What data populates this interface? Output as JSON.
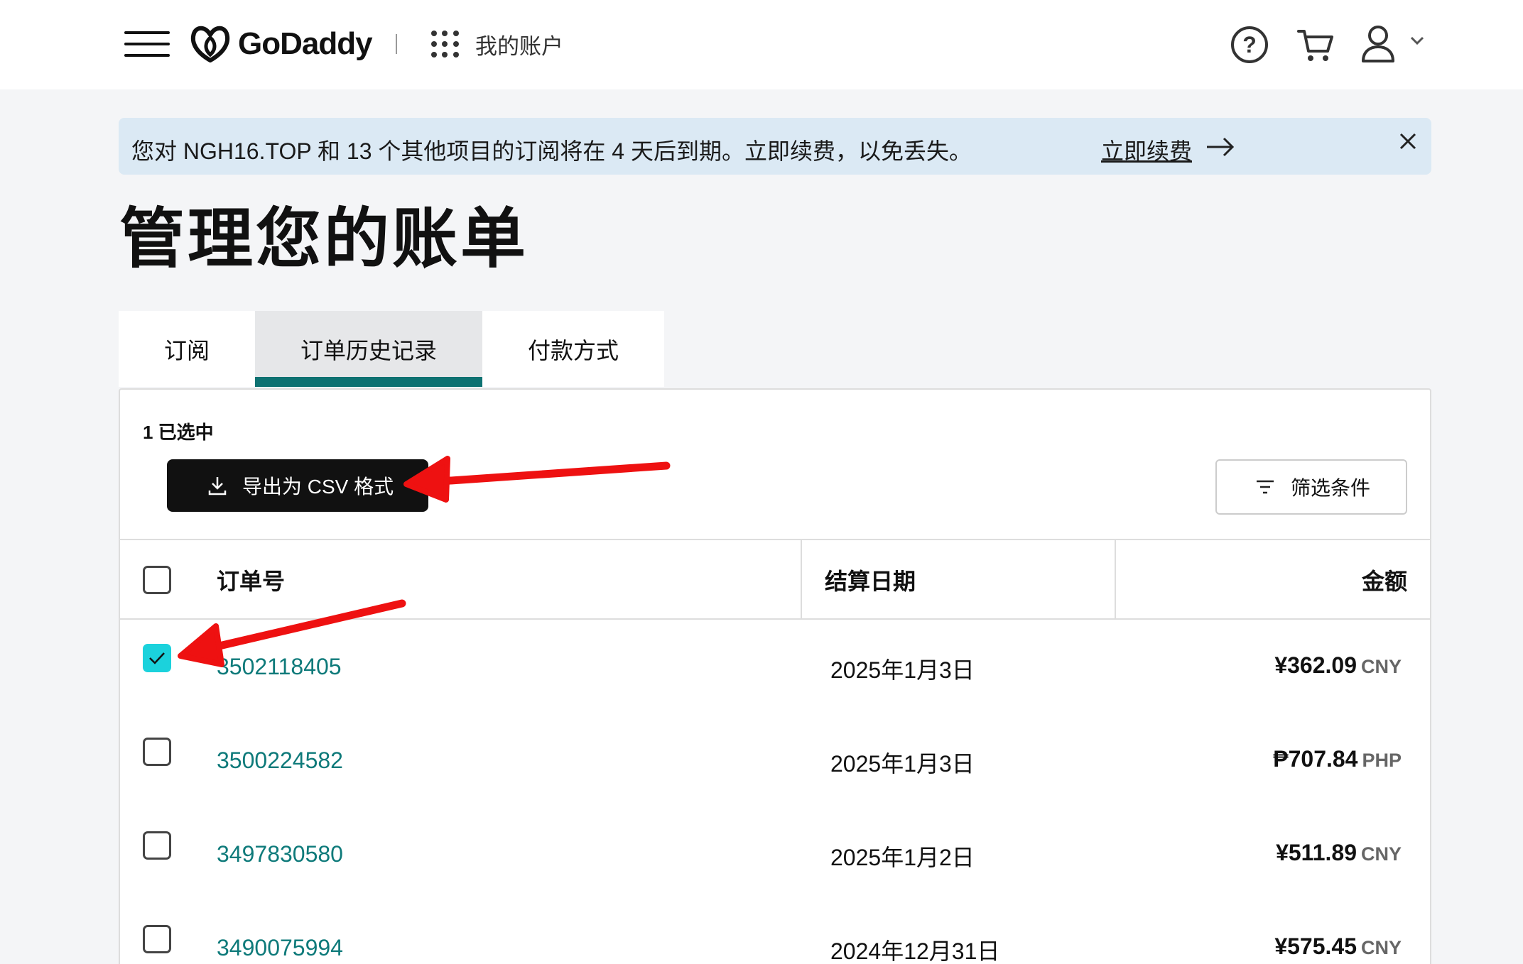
{
  "header": {
    "logo_text": "GoDaddy",
    "apps_label": "我的账户",
    "help_symbol": "?"
  },
  "banner": {
    "text": "您对 NGH16.TOP 和 13 个其他项目的订阅将在 4 天后到期。立即续费，以免丢失。",
    "link": "立即续费"
  },
  "page": {
    "title": "管理您的账单"
  },
  "tabs": [
    {
      "label": "订阅"
    },
    {
      "label": "订单历史记录"
    },
    {
      "label": "付款方式"
    }
  ],
  "toolbar": {
    "selected_count": "1 已选中",
    "export_label": "导出为 CSV 格式",
    "filter_label": "筛选条件"
  },
  "table": {
    "headers": {
      "order": "订单号",
      "date": "结算日期",
      "amount": "金额"
    },
    "rows": [
      {
        "order": "3502118405",
        "date": "2025年1月3日",
        "amount": "¥362.09",
        "currency": "CNY",
        "checked": true
      },
      {
        "order": "3500224582",
        "date": "2025年1月3日",
        "amount": "₱707.84",
        "currency": "PHP",
        "checked": false
      },
      {
        "order": "3497830580",
        "date": "2025年1月2日",
        "amount": "¥511.89",
        "currency": "CNY",
        "checked": false
      },
      {
        "order": "3490075994",
        "date": "2024年12月31日",
        "amount": "¥575.45",
        "currency": "CNY",
        "checked": false
      }
    ]
  },
  "colors": {
    "accent_teal": "#0e7272",
    "link_teal": "#0e7a7a",
    "checkbox_cyan": "#1bd2dc",
    "banner_bg": "#dbe9f4",
    "annotation_red": "#ee1111"
  }
}
